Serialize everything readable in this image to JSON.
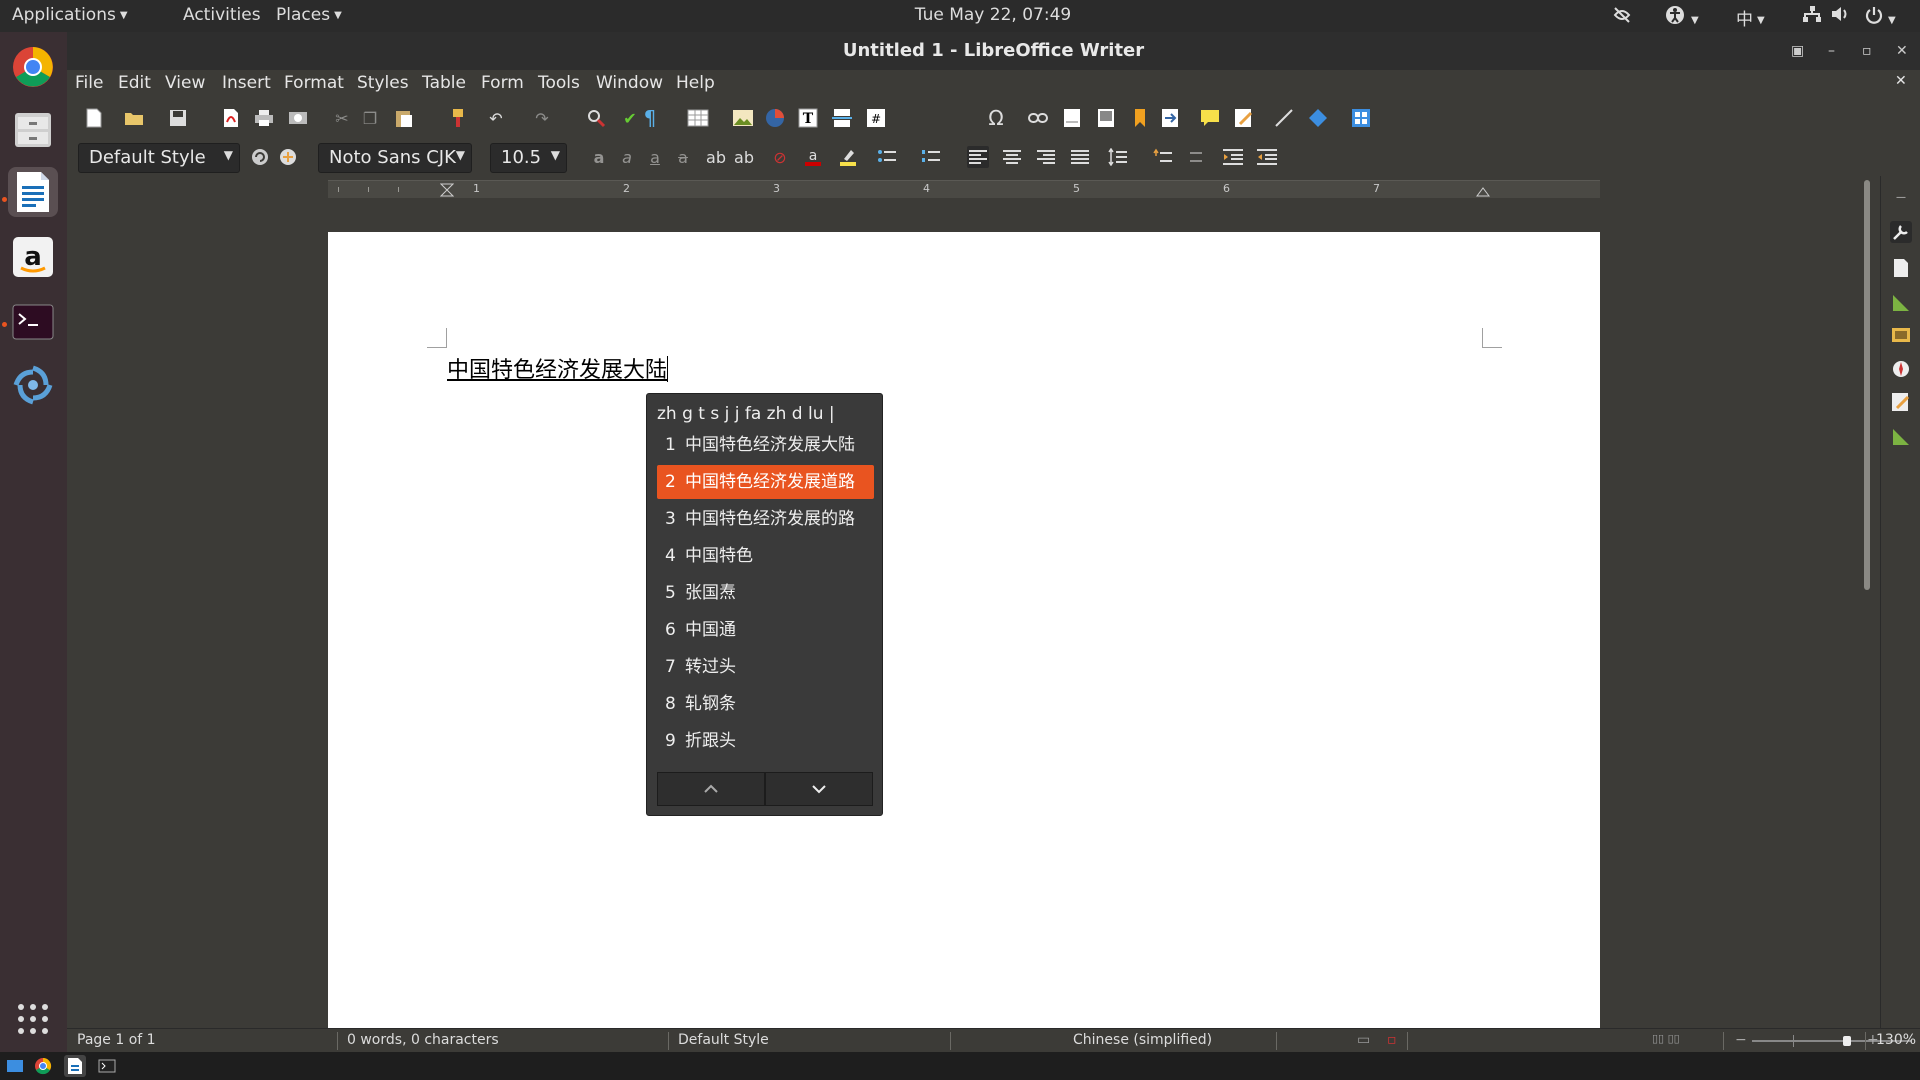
{
  "topbar": {
    "applications": "Applications",
    "activities": "Activities",
    "places": "Places",
    "clock": "Tue May 22, 07:49",
    "input_method": "中"
  },
  "window": {
    "title": "Untitled 1 - LibreOffice Writer"
  },
  "menubar": {
    "items": [
      "File",
      "Edit",
      "View",
      "Insert",
      "Format",
      "Styles",
      "Table",
      "Form",
      "Tools",
      "Window",
      "Help"
    ]
  },
  "formatting": {
    "paragraph_style": "Default Style",
    "font_name": "Noto Sans CJK",
    "font_size": "10.5"
  },
  "ruler": {
    "labels": [
      "1",
      "2",
      "3",
      "4",
      "5",
      "6",
      "7"
    ]
  },
  "document": {
    "text": "中国特色经济发展大陆"
  },
  "ime": {
    "preedit": "zh g t s j j fa zh d lu |",
    "selected_index": 1,
    "candidates": [
      {
        "num": "1",
        "text": "中国特色经济发展大陆"
      },
      {
        "num": "2",
        "text": "中国特色经济发展道路"
      },
      {
        "num": "3",
        "text": "中国特色经济发展的路"
      },
      {
        "num": "4",
        "text": "中国特色"
      },
      {
        "num": "5",
        "text": "张国焘"
      },
      {
        "num": "6",
        "text": "中国通"
      },
      {
        "num": "7",
        "text": "转过头"
      },
      {
        "num": "8",
        "text": "轧钢条"
      },
      {
        "num": "9",
        "text": "折跟头"
      }
    ]
  },
  "statusbar": {
    "page": "Page 1 of 1",
    "words": "0 words, 0 characters",
    "style": "Default Style",
    "language": "Chinese (simplified)",
    "zoom": "130%"
  },
  "colors": {
    "accent": "#e95420",
    "chrome": "#3c3b37",
    "topbar": "#2b2b2b"
  }
}
